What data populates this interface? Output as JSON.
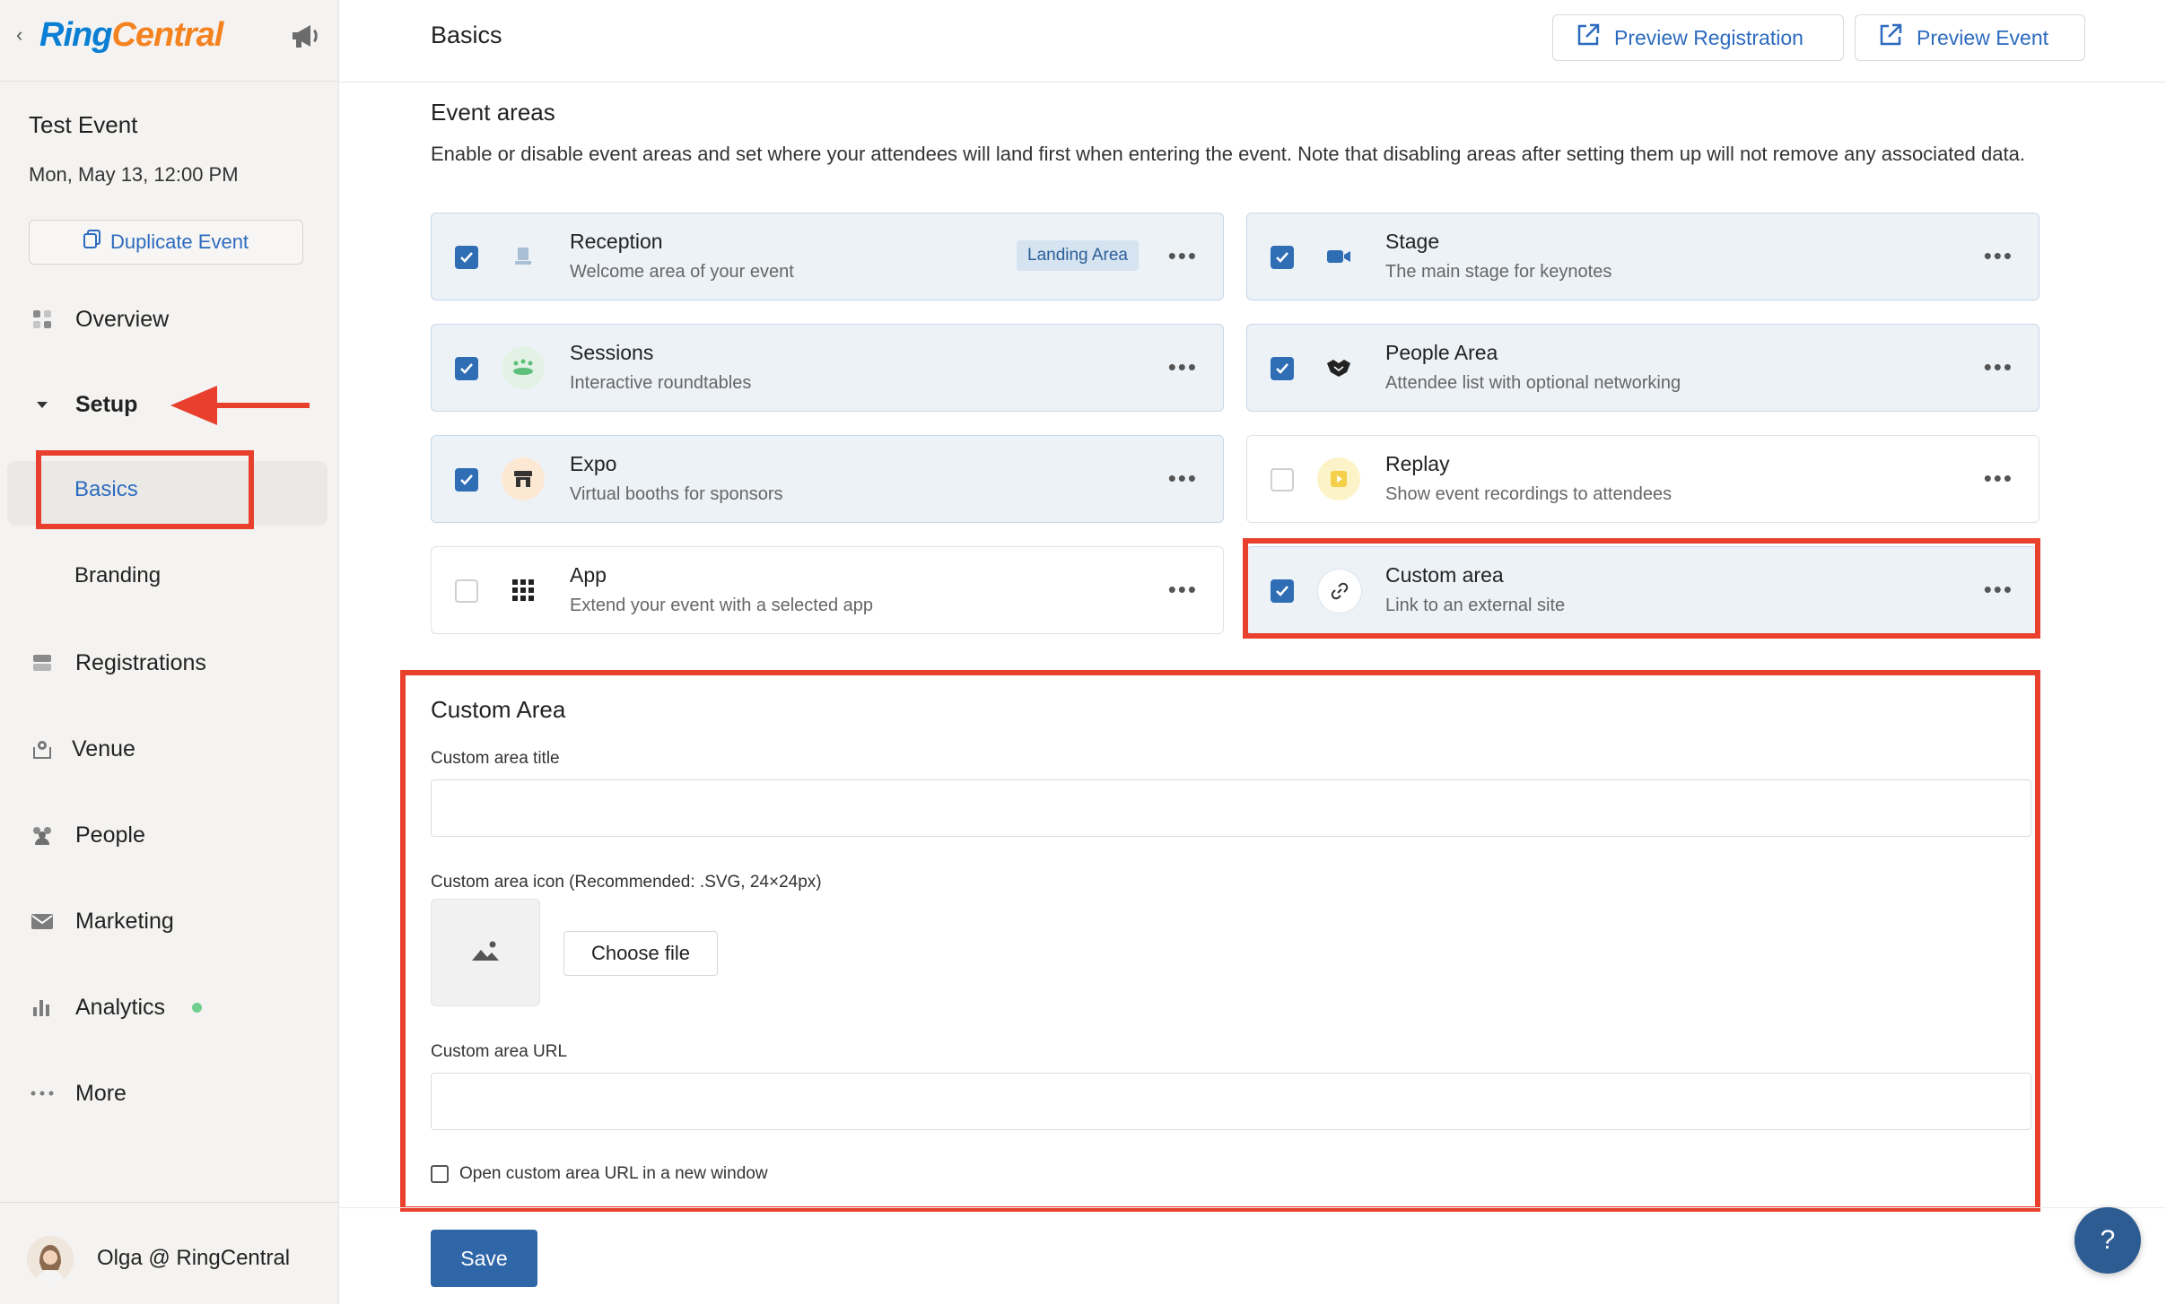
{
  "brand": {
    "ring": "Ring",
    "central": "Central"
  },
  "event": {
    "title": "Test Event",
    "date": "Mon, May 13, 12:00 PM",
    "duplicate_label": "Duplicate Event"
  },
  "nav": {
    "overview": "Overview",
    "setup": "Setup",
    "basics": "Basics",
    "branding": "Branding",
    "registrations": "Registrations",
    "venue": "Venue",
    "people": "People",
    "marketing": "Marketing",
    "analytics": "Analytics",
    "more": "More"
  },
  "user": {
    "name": "Olga @ RingCentral"
  },
  "header": {
    "title": "Basics",
    "preview_registration": "Preview Registration",
    "preview_event": "Preview Event"
  },
  "event_areas": {
    "title": "Event areas",
    "description": "Enable or disable event areas and set where your attendees will land first when entering the event. Note that disabling areas after setting them up will not remove any associated data.",
    "landing_badge": "Landing Area",
    "items": [
      {
        "name": "Reception",
        "sub": "Welcome area of your event",
        "checked": true,
        "icon": "reception-icon"
      },
      {
        "name": "Stage",
        "sub": "The main stage for keynotes",
        "checked": true,
        "icon": "video-camera-icon"
      },
      {
        "name": "Sessions",
        "sub": "Interactive roundtables",
        "checked": true,
        "icon": "roundtable-icon"
      },
      {
        "name": "People Area",
        "sub": "Attendee list with optional networking",
        "checked": true,
        "icon": "handshake-icon"
      },
      {
        "name": "Expo",
        "sub": "Virtual booths for sponsors",
        "checked": true,
        "icon": "booth-icon"
      },
      {
        "name": "Replay",
        "sub": "Show event recordings to attendees",
        "checked": false,
        "icon": "play-icon"
      },
      {
        "name": "App",
        "sub": "Extend your event with a selected app",
        "checked": false,
        "icon": "app-grid-icon"
      },
      {
        "name": "Custom area",
        "sub": "Link to an external site",
        "checked": true,
        "icon": "link-icon"
      }
    ]
  },
  "custom_area": {
    "title": "Custom Area",
    "title_label": "Custom area title",
    "icon_label": "Custom area icon (Recommended: .SVG, 24×24px)",
    "choose_file": "Choose file",
    "url_label": "Custom area URL",
    "new_window_label": "Open custom area URL in a new window"
  },
  "actions": {
    "save": "Save",
    "help": "?"
  },
  "colors": {
    "accent": "#2f6db5",
    "annotation_red": "#e8402d",
    "ring_blue": "#0a7fd4",
    "central_orange": "#f58220"
  }
}
